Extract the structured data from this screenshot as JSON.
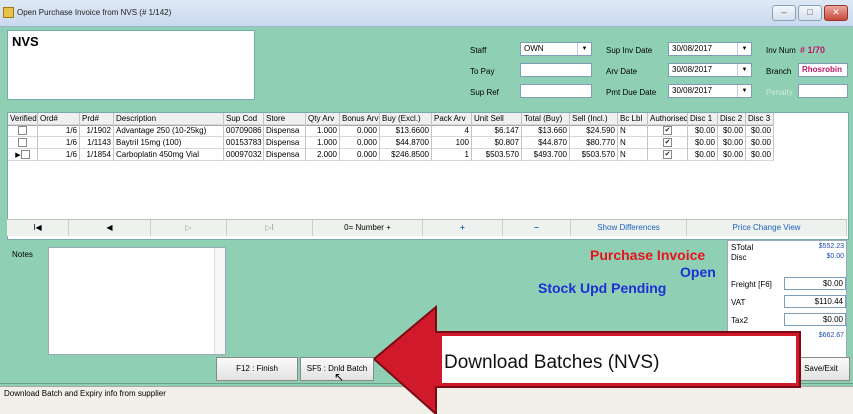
{
  "window": {
    "title": "Open Purchase Invoice from NVS (# 1/142)"
  },
  "supplier": "NVS",
  "header": {
    "staff_label": "Staff",
    "staff_value": "OWN",
    "topay_label": "To Pay",
    "topay_value": "",
    "supref_label": "Sup Ref",
    "supref_value": "",
    "supinvdate_label": "Sup Inv Date",
    "supinvdate_value": "30/08/2017",
    "arvdate_label": "Arv Date",
    "arvdate_value": "30/08/2017",
    "pmtdue_label": "Pmt Due Date",
    "pmtdue_value": "30/08/2017",
    "invnum_label": "Inv Num",
    "invnum_value": "# 1/70",
    "branch_label": "Branch",
    "branch_value": "Rhosrobin",
    "penalty_label": "Penalty",
    "penalty_value": ""
  },
  "grid": {
    "columns": [
      "Verified",
      "Ord#",
      "Prd#",
      "Description",
      "Sup Cod",
      "Store",
      "Qty Arv",
      "Bonus Arv",
      "Buy (Excl.)",
      "Pack Arv",
      "Unit Sell",
      "Total (Buy)",
      "Sell (Incl.)",
      "Bc Lbl",
      "Authorised",
      "Disc 1",
      "Disc 2",
      "Disc 3"
    ],
    "rows": [
      {
        "ord": "1/6",
        "prd": "1/1902",
        "desc": "Advantage 250 (10-25kg)",
        "supcod": "00709086",
        "store": "Dispensa",
        "qty": "1.000",
        "bonus": "0.000",
        "buy": "$13.6600",
        "pack": "4",
        "unit": "$6.147",
        "total": "$13.660",
        "sell": "$24.590",
        "bclbl": "N",
        "d1": "$0.00",
        "d2": "$0.00",
        "d3": "$0.00"
      },
      {
        "ord": "1/6",
        "prd": "1/1143",
        "desc": "Baytril 15mg (100)",
        "supcod": "00153783",
        "store": "Dispensa",
        "qty": "1.000",
        "bonus": "0.000",
        "buy": "$44.8700",
        "pack": "100",
        "unit": "$0.807",
        "total": "$44.870",
        "sell": "$80.770",
        "bclbl": "N",
        "d1": "$0.00",
        "d2": "$0.00",
        "d3": "$0.00"
      },
      {
        "ord": "1/6",
        "prd": "1/1854",
        "desc": "Carboplatin 450mg Vial",
        "supcod": "00097032",
        "store": "Dispensa",
        "qty": "2.000",
        "bonus": "0.000",
        "buy": "$246.8500",
        "pack": "1",
        "unit": "$503.570",
        "total": "$493.700",
        "sell": "$503.570",
        "bclbl": "N",
        "d1": "$0.00",
        "d2": "$0.00",
        "d3": "$0.00"
      }
    ]
  },
  "nav": {
    "first": "I◀",
    "prev": "◀",
    "next": "▷",
    "last": "▷I",
    "number": "0= Number +",
    "add": "+",
    "remove": "−",
    "show_diff": "Show Differences",
    "price_change": "Price Change View"
  },
  "notes_label": "Notes",
  "status": {
    "line1": "Purchase Invoice",
    "line2": "Open",
    "line3": "Stock Upd Pending"
  },
  "totals": {
    "stotal_label": "STotal",
    "stotal_value": "$552.23",
    "disc_label": "Disc",
    "disc_value": "$0.00",
    "freight_label": "Freight [F6]",
    "freight_value": "$0.00",
    "vat_label": "VAT",
    "vat_value": "$110.44",
    "tax2_label": "Tax2",
    "tax2_value": "$0.00",
    "total_value": "$662.67"
  },
  "buttons": {
    "f12": "F12 : Finish",
    "sf5": "SF5 : Dnld Batch",
    "save": "Save/Exit"
  },
  "statusbar": "Download Batch and Expiry info from supplier",
  "callout": "Download Batches (NVS)"
}
